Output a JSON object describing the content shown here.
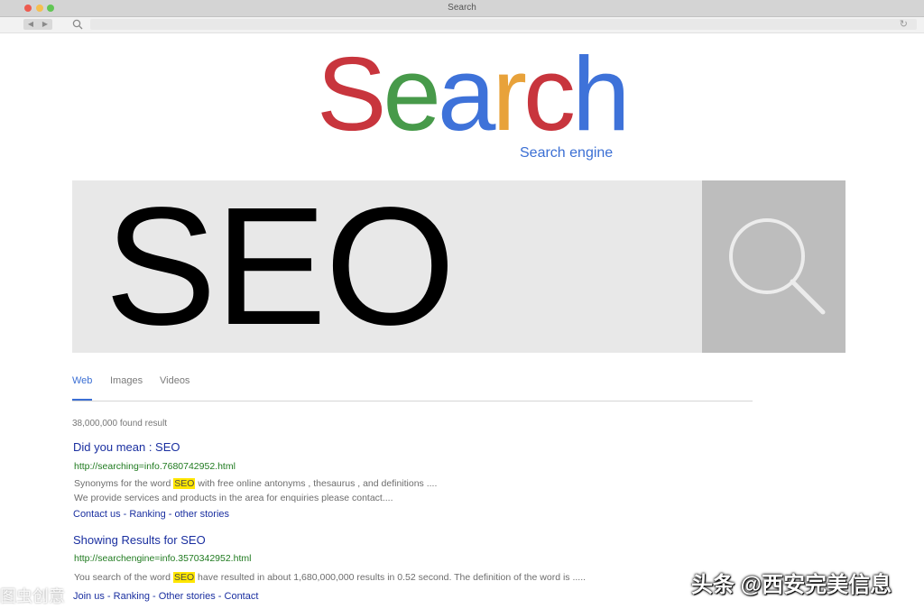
{
  "window": {
    "title": "Search"
  },
  "colors": {
    "close": "#ed5b4f",
    "minimize": "#f5bf4f",
    "maximize": "#61c654",
    "accent": "#3b6fd4"
  },
  "toolbar": {
    "back": "◀",
    "forward": "▶",
    "reload": "↻"
  },
  "logo": {
    "letters": [
      {
        "char": "S",
        "color": "#c8353d"
      },
      {
        "char": "e",
        "color": "#479a4a"
      },
      {
        "char": "a",
        "color": "#3e72d9"
      },
      {
        "char": "r",
        "color": "#e8a23a"
      },
      {
        "char": "c",
        "color": "#c8353d"
      },
      {
        "char": "h",
        "color": "#3e72d9"
      }
    ],
    "tagline": "Search engine"
  },
  "search": {
    "query": "SEO",
    "button_icon": "magnifier-icon"
  },
  "tabs": [
    {
      "label": "Web",
      "active": true
    },
    {
      "label": "Images",
      "active": false
    },
    {
      "label": "Videos",
      "active": false
    }
  ],
  "results_count": "38,000,000 found result",
  "results": [
    {
      "title": "Did you mean : SEO",
      "url": "http://searching=info.7680742952.html",
      "desc1_before": "Synonyms for the word ",
      "desc1_hl": "SEO",
      "desc1_after": " with free online antonyms , thesaurus , and definitions ....",
      "desc2": "We provide services and products in the area for enquiries please contact....",
      "links": "Contact us - Ranking - other stories"
    },
    {
      "title": "Showing Results for SEO",
      "url": "http://searchengine=info.3570342952.html",
      "desc1_before": "You search of the word ",
      "desc1_hl": "SEO",
      "desc1_after": " have resulted in about 1,680,000,000 results in 0.52 second. The definition of the word is .....",
      "links": "Join us - Ranking - Other stories - Contact"
    }
  ],
  "watermark": "头条 @西安完美信息",
  "watermark_left": "图虫创意"
}
